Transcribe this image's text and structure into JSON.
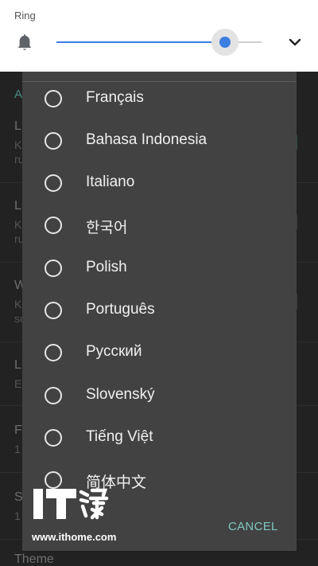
{
  "volume": {
    "stream_label": "Ring",
    "level": 0.82,
    "icons": {
      "stream": "bell-icon",
      "expand": "chevron-down-icon"
    }
  },
  "dialog": {
    "options": [
      {
        "label": "Français",
        "selected": false
      },
      {
        "label": "Bahasa Indonesia",
        "selected": false
      },
      {
        "label": "Italiano",
        "selected": false
      },
      {
        "label": "한국어",
        "selected": false
      },
      {
        "label": "Polish",
        "selected": false
      },
      {
        "label": "Português",
        "selected": false
      },
      {
        "label": "Русский",
        "selected": false
      },
      {
        "label": "Slovenský",
        "selected": false
      },
      {
        "label": "Tiếng Việt",
        "selected": false
      },
      {
        "label": "简体中文",
        "selected": false
      }
    ],
    "cancel_label": "CANCEL"
  },
  "background": {
    "section_initial": "A",
    "rows": [
      {
        "title": "L",
        "sub1": "K",
        "sub2": "ru"
      },
      {
        "title": "L",
        "sub1": "K",
        "sub2": "ru"
      },
      {
        "title": "W",
        "sub1": "K",
        "sub2": "sc"
      },
      {
        "title": "L",
        "sub1": "E"
      },
      {
        "title": "F",
        "sub1": "1"
      },
      {
        "title": "S",
        "sub1": "1"
      }
    ],
    "theme_label": "Theme"
  },
  "watermark": {
    "logo_text": "IT之家",
    "url": "www.ithome.com"
  },
  "colors": {
    "accent": "#3c7de0",
    "dialog_bg": "#424242",
    "cancel_text": "#7ec8c0",
    "panel_bg": "#ffffff"
  }
}
